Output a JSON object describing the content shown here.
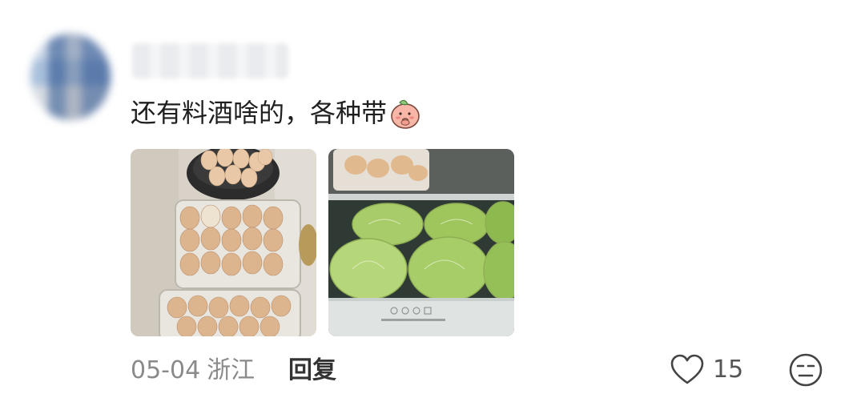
{
  "comment": {
    "text": "还有料酒啥的，各种带",
    "emoji": "peach-face-emoji",
    "date": "05-04",
    "location": "浙江",
    "reply_label": "回复",
    "like_count": "15"
  },
  "images": [
    "eggs-in-containers-photo",
    "cabbages-in-fridge-drawer-photo"
  ],
  "icons": [
    "heart-icon",
    "dislike-face-icon"
  ]
}
